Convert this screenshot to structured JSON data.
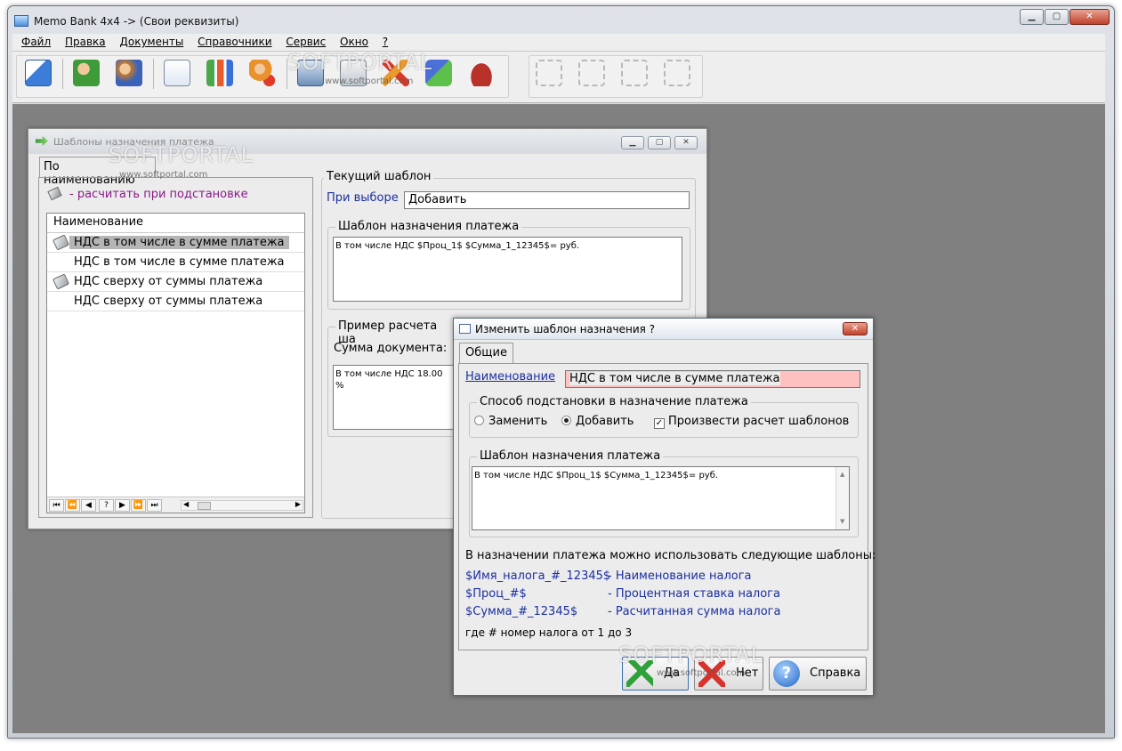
{
  "app": {
    "title": "Memo Bank 4x4 -> (Свои реквизиты)"
  },
  "menu": [
    "Файл",
    "Правка",
    "Документы",
    "Справочники",
    "Сервис",
    "Окно",
    "?"
  ],
  "toolbar_icons": [
    "edit-document-icon",
    "contact-card-icon",
    "users-icon",
    "documents-icon",
    "bar-chart-icon",
    "user-delete-icon",
    "calculator-icon",
    "notes-icon",
    "tools-icon",
    "blocks-icon",
    "wallet-icon",
    "forward-icon",
    "copy-icon",
    "pen-icon",
    "cancel-icon"
  ],
  "watermark": {
    "brand": "SOFTPORTAL",
    "url": "www.softportal.com"
  },
  "templates_window": {
    "title": "Шаблоны назначения платежа",
    "tab_label": "По наименованию",
    "legend_hint": "- расчитать при подстановке",
    "grid": {
      "header": "Наименование",
      "rows": [
        {
          "text": "НДС в том числе в сумме платежа",
          "has_icon": true,
          "selected": true
        },
        {
          "text": "НДС в том числе в сумме платежа",
          "has_icon": false,
          "selected": false
        },
        {
          "text": "НДС сверху от суммы платежа",
          "has_icon": true,
          "selected": false
        },
        {
          "text": "НДС сверху от суммы платежа",
          "has_icon": false,
          "selected": false
        }
      ],
      "nav": [
        "⏮",
        "⏪",
        "◀",
        "?",
        "▶",
        "⏩",
        "⏭"
      ]
    },
    "current": {
      "legend": "Текущий шаблон",
      "on_select_label": "При выборе",
      "on_select_value": "Добавить",
      "template_legend": "Шаблон назначения платежа",
      "template_text": "В том числе НДС $Проц_1$ $Сумма_1_12345$= руб.",
      "example_legend": "Пример расчета ша",
      "doc_sum_label": "Сумма документа:",
      "example_text": "В том числе НДС 18.00 %"
    }
  },
  "dialog": {
    "title": "Изменить шаблон назначения ?",
    "tab_label": "Общие",
    "name_label": "Наименование",
    "name_value": "НДС в том числе в сумме платежа",
    "method_legend": "Способ подстановки в назначение платежа",
    "radio_replace": "Заменить",
    "radio_add": "Добавить",
    "checkbox_calc": "Произвести расчет шаблонов",
    "template_legend": "Шаблон назначения платежа",
    "template_text": "В том числе НДС $Проц_1$ $Сумма_1_12345$= руб.",
    "info": "В назначении платежа можно использовать следующие шаблоны:",
    "hints": [
      {
        "code": "$Имя_налога_#_12345$",
        "desc": "- Наименование налога"
      },
      {
        "code": "$Проц_#$",
        "desc": "- Процентная ставка налога"
      },
      {
        "code": "$Сумма_#_12345$",
        "desc": "- Расчитанная сумма налога"
      }
    ],
    "footnote": "где # номер налога от 1 до 3",
    "buttons": {
      "ok": "Да",
      "no": "Нет",
      "help": "Справка"
    }
  },
  "colors": {
    "mdi_background": "#808080",
    "selected_row": "#b5b5b5",
    "name_field": "#ffc0c0",
    "link_blue": "#1b2fa0",
    "hint_purple": "#8a1a8a"
  }
}
